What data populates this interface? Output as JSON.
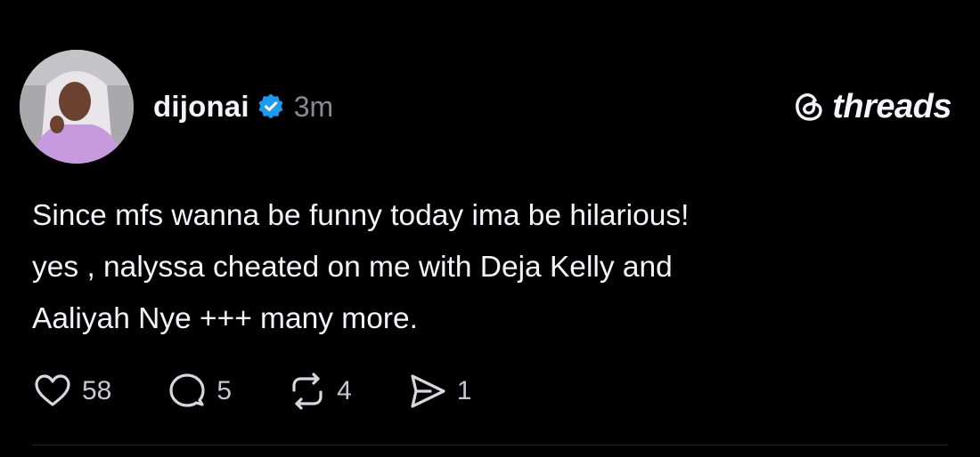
{
  "post": {
    "username": "dijonai",
    "time": "3m",
    "lines": [
      "Since mfs wanna be funny today ima be hilarious!",
      "yes , nalyssa cheated on me with Deja Kelly and",
      "Aaliyah Nye +++ many more."
    ]
  },
  "brand": {
    "name": "threads",
    "icon": "threads-logo-icon"
  },
  "actions": {
    "like": {
      "icon": "heart-icon",
      "count": "58"
    },
    "reply": {
      "icon": "comment-icon",
      "count": "5"
    },
    "repost": {
      "icon": "repost-icon",
      "count": "4"
    },
    "share": {
      "icon": "send-icon",
      "count": "1"
    }
  },
  "colors": {
    "background": "#000000",
    "text": "#f3f5f7",
    "muted": "#8a8a8f",
    "verified": "#1d9bf0"
  }
}
